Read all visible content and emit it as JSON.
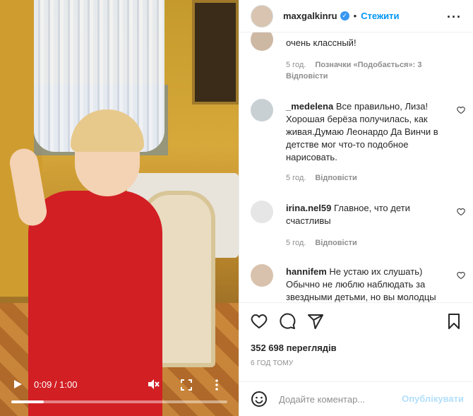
{
  "video": {
    "time": "0:09 / 1:00",
    "progress": 0.15
  },
  "header": {
    "username": "maxgalkinru",
    "follow_label": "Стежити",
    "dot": "•"
  },
  "comments": [
    {
      "username": "",
      "text": "очень классный!",
      "time": "5 год.",
      "likes": "Позначки «Подобається»: 3",
      "reply": "Відповісти"
    },
    {
      "username": "_medelena",
      "text": "Все правильно, Лиза! Хорошая берёза получилась, как живая.Думаю Леонардо Да Винчи в детстве мог что-то подобное нарисовать.",
      "time": "5 год.",
      "reply": "Відповісти"
    },
    {
      "username": "irina.nel59",
      "text": "Главное, что дети счастливы",
      "time": "5 год.",
      "reply": "Відповісти"
    },
    {
      "username": "hannifem",
      "text": "Не устаю их слушать) Обычно не люблю наблюдать за звездными детьми, но вы молодцы",
      "time": "",
      "reply": ""
    }
  ],
  "stats": {
    "views": "352 698 переглядів",
    "time_ago": "6 ГОД ТОМУ"
  },
  "comment_box": {
    "placeholder": "Додайте коментар...",
    "publish_label": "Опублікувати"
  },
  "colors": {
    "accent": "#0095f6",
    "verified": "#3897f0",
    "muted": "#8e8e8e",
    "publish_disabled": "#b2dffc"
  },
  "icons": {
    "like": "heart-icon",
    "comment": "comment-bubble-icon",
    "share": "send-arrow-icon",
    "save": "bookmark-icon",
    "emoji": "smiley-icon",
    "options": "more-dots-icon"
  }
}
